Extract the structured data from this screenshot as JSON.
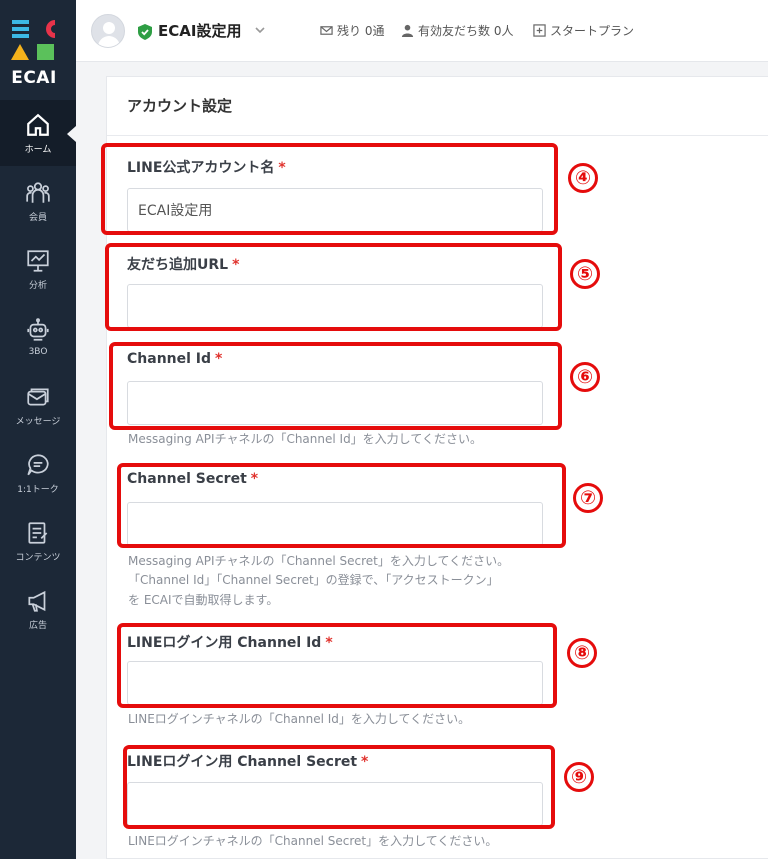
{
  "brand": {
    "name": "ECAI"
  },
  "sidebar": {
    "items": [
      {
        "label": "ホーム",
        "icon": "home-icon"
      },
      {
        "label": "会員",
        "icon": "members-icon"
      },
      {
        "label": "分析",
        "icon": "analytics-icon"
      },
      {
        "label": "3BO",
        "icon": "robot-icon"
      },
      {
        "label": "メッセージ",
        "icon": "message-icon"
      },
      {
        "label": "1:1トーク",
        "icon": "chat-icon"
      },
      {
        "label": "コンテンツ",
        "icon": "content-icon"
      },
      {
        "label": "広告",
        "icon": "megaphone-icon"
      }
    ]
  },
  "topbar": {
    "account_name": "ECAI設定用",
    "remaining": "残り 0通",
    "friends": "有効友だち数 0人",
    "plan": "スタートプラン"
  },
  "panel": {
    "title": "アカウント設定"
  },
  "form": {
    "fields": [
      {
        "label": "LINE公式アカウント名",
        "required": "*",
        "value": "ECAI設定用",
        "help": []
      },
      {
        "label": "友だち追加URL",
        "required": "*",
        "value": "",
        "help": []
      },
      {
        "label": "Channel Id",
        "required": "*",
        "value": "",
        "help": [
          "Messaging APIチャネルの「Channel Id」を入力してください。"
        ]
      },
      {
        "label": "Channel Secret",
        "required": "*",
        "value": "",
        "help": [
          "Messaging APIチャネルの「Channel Secret」を入力してください。",
          "「Channel Id」「Channel Secret」の登録で、「アクセストークン」",
          "を ECAIで自動取得します。"
        ]
      },
      {
        "label": "LINEログイン用 Channel Id",
        "required": "*",
        "value": "",
        "help": [
          "LINEログインチャネルの「Channel Id」を入力してください。"
        ]
      },
      {
        "label": "LINEログイン用 Channel Secret",
        "required": "*",
        "value": "",
        "help": [
          "LINEログインチャネルの「Channel Secret」を入力してください。"
        ]
      }
    ]
  },
  "annotations": {
    "colors": {
      "highlight": "#e50c0c"
    },
    "numbers": [
      "④",
      "⑤",
      "⑥",
      "⑦",
      "⑧",
      "⑨"
    ]
  },
  "colors": {
    "sidebar_bg": "#1c2837",
    "required": "#e0322d",
    "shield": "#2e9e44"
  }
}
